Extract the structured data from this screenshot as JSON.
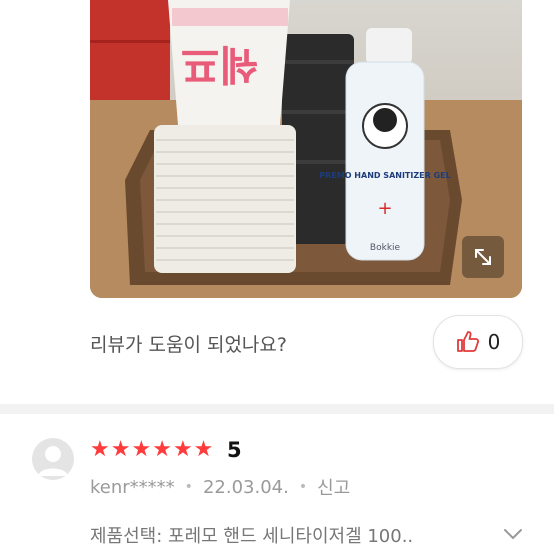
{
  "photo": {
    "cup_text": "쉐프",
    "bottle_brand": "PREMO HAND SANITIZER GEL",
    "bottle_small": "Bokkie"
  },
  "expand_icon": "expand-arrows-icon",
  "helpful": {
    "question": "리뷰가 도움이 되었나요?",
    "count": "0"
  },
  "review": {
    "rating": 5,
    "rating_label": "5",
    "star_color": "#ff3b3b",
    "username": "kenr*****",
    "date": "22.03.04.",
    "report": "신고",
    "option_text": "제품선택: 포레모 핸드 세니타이저겔 100.."
  }
}
